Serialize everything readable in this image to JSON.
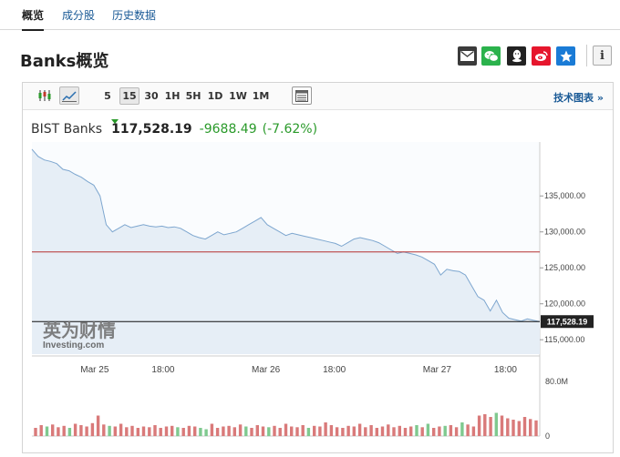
{
  "tabs": [
    {
      "label": "概览",
      "active": true
    },
    {
      "label": "成分股",
      "active": false
    },
    {
      "label": "历史数据",
      "active": false
    }
  ],
  "page_title": "Banks概览",
  "share_icons": [
    {
      "name": "email-icon",
      "color": "#333333"
    },
    {
      "name": "wechat-icon",
      "color": "#2bb24c"
    },
    {
      "name": "qq-icon",
      "color": "#222222"
    },
    {
      "name": "weibo-icon",
      "color": "#e6162d"
    },
    {
      "name": "qzone-icon",
      "color": "#1a7bd6"
    }
  ],
  "info_label": "i",
  "toolbar": {
    "periods": [
      {
        "label": "5",
        "selected": false
      },
      {
        "label": "15",
        "selected": true
      },
      {
        "label": "30",
        "selected": false
      },
      {
        "label": "1H",
        "selected": false
      },
      {
        "label": "5H",
        "selected": false
      },
      {
        "label": "1D",
        "selected": false
      },
      {
        "label": "1W",
        "selected": false
      },
      {
        "label": "1M",
        "selected": false
      }
    ],
    "tech_chart_label": "技术图表 »"
  },
  "quote": {
    "name": "BIST Banks",
    "last": "117,528.19",
    "change": "-9688.49",
    "change_pct": "(-7.62%)"
  },
  "watermark": {
    "cn": "英为财情",
    "en": "Investing.com"
  },
  "colors": {
    "up": "#2a9a2a",
    "down": "#c0392b",
    "line": "#7da6cf",
    "area": "#e6eef6",
    "prev_close": "#b53030"
  },
  "chart_data": {
    "type": "area",
    "title": "",
    "xlabel": "",
    "ylabel": "",
    "y_ticks": [
      "135,000.00",
      "130,000.00",
      "125,000.00",
      "120,000.00",
      "115,000.00"
    ],
    "y_tick_values": [
      135000,
      130000,
      125000,
      120000,
      115000
    ],
    "ylim": [
      113000,
      142500
    ],
    "x_ticks": [
      "Mar 25",
      "18:00",
      "Mar 26",
      "18:00",
      "Mar 27",
      "18:00"
    ],
    "x_tick_index": [
      11,
      23,
      41,
      53,
      71,
      83
    ],
    "grid": false,
    "prev_close": 127216,
    "current_value": 117528.19,
    "current_label": "117,528.19",
    "price": [
      141500,
      140500,
      140000,
      139800,
      139500,
      138700,
      138500,
      138000,
      137600,
      137000,
      136500,
      135000,
      131000,
      130000,
      130500,
      131000,
      130600,
      130800,
      131000,
      130800,
      130700,
      130800,
      130600,
      130700,
      130500,
      130000,
      129500,
      129200,
      129000,
      129500,
      130000,
      129600,
      129800,
      130000,
      130500,
      131000,
      131500,
      132000,
      131000,
      130500,
      130000,
      129500,
      129800,
      129600,
      129400,
      129200,
      129000,
      128800,
      128600,
      128400,
      128000,
      128500,
      129000,
      129200,
      129000,
      128800,
      128500,
      128000,
      127500,
      127000,
      127200,
      127000,
      126800,
      126500,
      126000,
      125500,
      124000,
      124800,
      124600,
      124500,
      124000,
      122500,
      121000,
      120500,
      119000,
      120500,
      118800,
      118000,
      117800,
      117600,
      117900,
      117700,
      117528
    ],
    "volume_ylim": [
      0,
      80
    ],
    "volume_ticks": [
      "80.0M",
      "0"
    ],
    "volume_tick_values": [
      80,
      0
    ],
    "volume": [
      12,
      16,
      14,
      17,
      13,
      15,
      12,
      18,
      16,
      14,
      19,
      30,
      17,
      15,
      14,
      18,
      13,
      15,
      12,
      14,
      13,
      16,
      12,
      14,
      15,
      13,
      12,
      15,
      14,
      12,
      10,
      18,
      12,
      14,
      15,
      13,
      17,
      14,
      12,
      16,
      14,
      13,
      15,
      12,
      18,
      14,
      13,
      16,
      12,
      15,
      14,
      20,
      16,
      13,
      12,
      15,
      14,
      18,
      13,
      16,
      12,
      14,
      17,
      13,
      15,
      12,
      14,
      16,
      13,
      18,
      12,
      14,
      15,
      16,
      13,
      20,
      17,
      14,
      30,
      32,
      28,
      34,
      30,
      26,
      24,
      22,
      28,
      25,
      23
    ],
    "volume_up": [
      false,
      false,
      true,
      false,
      false,
      false,
      true,
      false,
      false,
      false,
      false,
      false,
      false,
      true,
      false,
      false,
      false,
      false,
      false,
      false,
      false,
      false,
      false,
      false,
      false,
      true,
      false,
      false,
      false,
      true,
      true,
      false,
      false,
      false,
      false,
      false,
      false,
      true,
      false,
      false,
      false,
      true,
      false,
      false,
      false,
      false,
      false,
      false,
      true,
      false,
      false,
      false,
      false,
      false,
      false,
      false,
      false,
      false,
      false,
      false,
      false,
      false,
      false,
      false,
      false,
      false,
      false,
      true,
      false,
      true,
      false,
      false,
      true,
      false,
      false,
      true,
      false,
      false,
      false,
      false,
      false,
      true,
      false,
      false,
      false,
      false,
      false,
      false,
      false
    ]
  }
}
